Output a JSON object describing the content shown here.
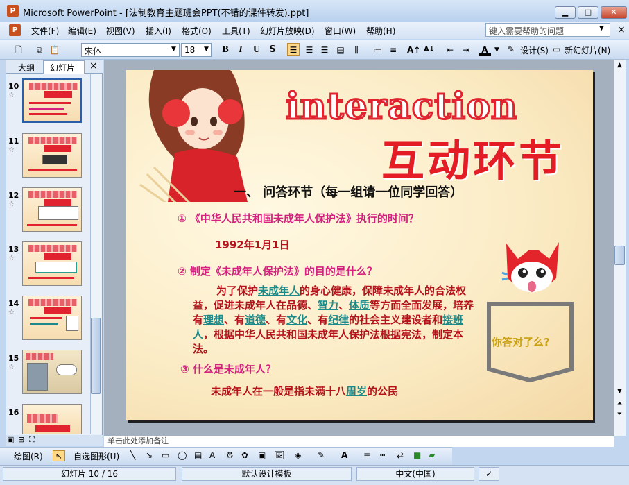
{
  "window": {
    "app_icon": "P",
    "title": "Microsoft PowerPoint - [法制教育主题班会PPT(不错的课件转发).ppt]",
    "minimize": "▁",
    "maximize": "□",
    "close": "✕"
  },
  "menu": {
    "icon": "P",
    "items": [
      "文件(F)",
      "编辑(E)",
      "视图(V)",
      "插入(I)",
      "格式(O)",
      "工具(T)",
      "幻灯片放映(D)",
      "窗口(W)",
      "帮助(H)"
    ],
    "help_placeholder": "键入需要帮助的问题",
    "doc_close": "×"
  },
  "toolbar": {
    "font_name": "宋体",
    "font_size": "18",
    "bold": "B",
    "italic": "I",
    "underline": "U",
    "shadow": "S",
    "design_label": "设计(S)",
    "new_slide_label": "新幻灯片(N)"
  },
  "panel": {
    "tab_outline": "大纲",
    "tab_slides": "幻灯片",
    "close": "×",
    "thumbnails": [
      {
        "num": "10",
        "star": "☆"
      },
      {
        "num": "11",
        "star": "☆"
      },
      {
        "num": "12",
        "star": "☆"
      },
      {
        "num": "13",
        "star": "☆"
      },
      {
        "num": "14",
        "star": "☆"
      },
      {
        "num": "15",
        "star": "☆"
      },
      {
        "num": "16",
        "star": ""
      }
    ]
  },
  "slide": {
    "title_en": "interaction",
    "title_zh": "互动环节",
    "section": "一、 问答环节（每一组请一位同学回答）",
    "q1": "①  《中华人民共和国未成年人保护法》执行的时间？",
    "a1": "1992年1月1日",
    "q2": "②  制定《未成年人保护法》的目的是什么？",
    "a2": {
      "p1": "为了保护",
      "h1": "未成年人",
      "p2": "的身心健康，保障未成年人的合法权益，促进未成年人在品德、",
      "h2": "智力",
      "p3": "、",
      "h3": "体质",
      "p4": "等方面全面发展，培养有",
      "h4": "理想",
      "p5": "、有",
      "h5": "道德",
      "p6": "、有",
      "h6": "文化",
      "p7": "、有",
      "h7": "纪律",
      "p8": "的社会主义建设者和",
      "h8": "接班人",
      "p9": "，根据中华人民共和国未成年人保护法根据宪法，制定本法。"
    },
    "q3": "③  什么是未成年人？",
    "a3_pre": "未成年人在一般是指未满十八",
    "a3_hl": "周岁",
    "a3_post": "的公民",
    "pocket_text": "你答对了么?"
  },
  "notes": "单击此处添加备注",
  "drawbar": {
    "draw_label": "绘图(R)",
    "autoshapes_label": "自选图形(U)"
  },
  "status": {
    "slide_pos": "幻灯片 10 / 16",
    "template": "默认设计模板",
    "language": "中文(中国)"
  },
  "colors": {
    "title_red": "#e41c26",
    "question_pink": "#d4217f",
    "answer_red": "#b5121b",
    "highlight_teal": "#1c8a8a",
    "pocket_gold": "#caa013"
  }
}
